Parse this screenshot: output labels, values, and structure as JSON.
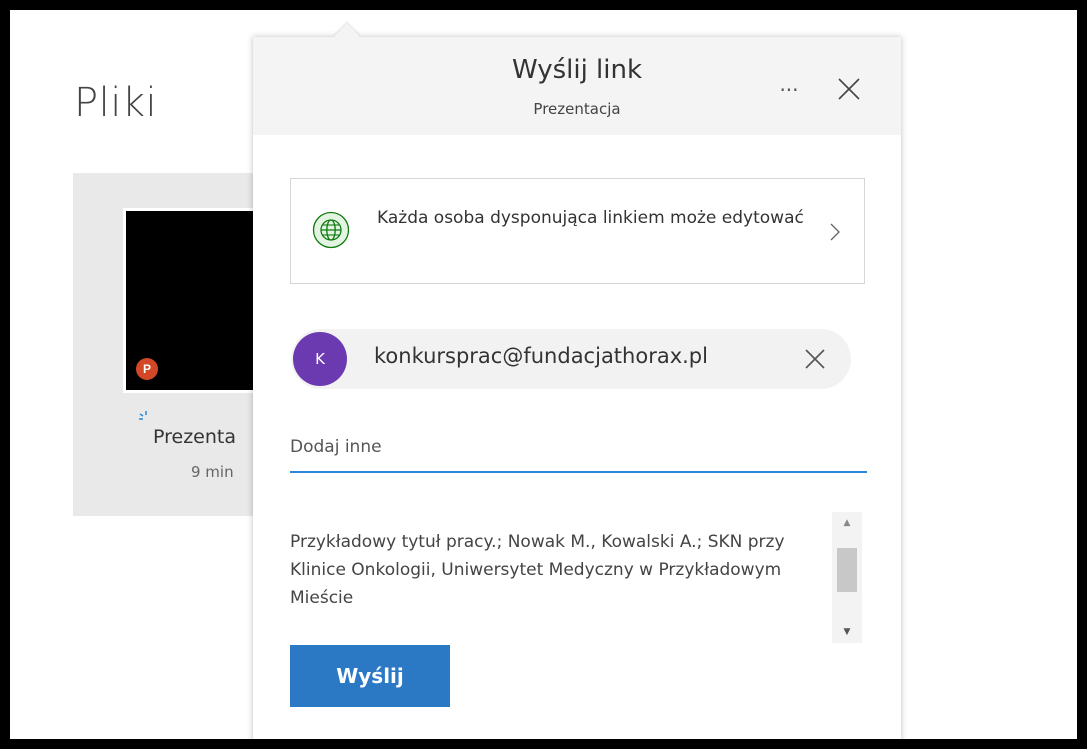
{
  "page": {
    "title": "Pliki"
  },
  "file_tile": {
    "name": "Prezenta",
    "modified": "9 min",
    "file_icon": "powerpoint-icon",
    "file_icon_letter": "P",
    "status_icon": "sync-spinner-icon"
  },
  "share_dialog": {
    "title": "Wyślij link",
    "subtitle": "Prezentacja",
    "more_label": "...",
    "permission": {
      "text": "Każda osoba dysponująca linkiem może edytować",
      "icon": "globe-icon"
    },
    "recipient": {
      "initial": "K",
      "email": "konkursprac@fundacjathorax.pl"
    },
    "add_placeholder": "Dodaj inne",
    "message": "Przykładowy tytuł pracy.; Nowak M., Kowalski A.; SKN przy Klinice Onkologii, Uniwersytet Medyczny w Przykładowym Mieście",
    "send_label": "Wyślij"
  },
  "colors": {
    "accent": "#2b78c5",
    "avatar": "#6b3ab0",
    "globe": "#107c10",
    "powerpoint": "#d24726",
    "header_bg": "#f4f4f4"
  }
}
